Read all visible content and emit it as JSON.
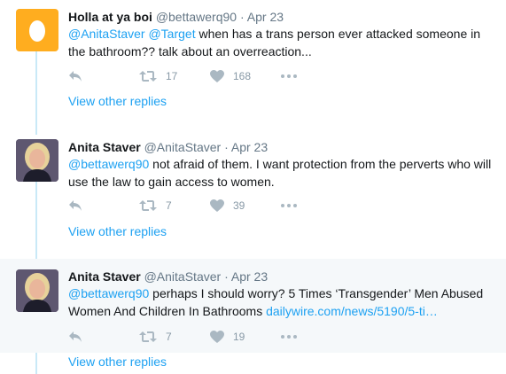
{
  "tweets": [
    {
      "name": "Holla at ya boi",
      "handle": "@bettawerq90",
      "separator": "·",
      "time": "Apr 23",
      "text_mentions": "@AnitaStaver @Target",
      "text_body": " when has a trans person ever attacked someone in the bathroom?? talk about an overreaction...",
      "retweets": "17",
      "likes": "168",
      "more_replies": "View other replies",
      "avatar": "egg-avatar-icon"
    },
    {
      "name": "Anita Staver",
      "handle": "@AnitaStaver",
      "separator": "·",
      "time": "Apr 23",
      "text_mentions": "@bettawerq90",
      "text_body": " not afraid of them. I want protection from the perverts who will use the law to gain access to women.",
      "retweets": "7",
      "likes": "39",
      "more_replies": "View other replies",
      "avatar": "profile-photo"
    },
    {
      "name": "Anita Staver",
      "handle": "@AnitaStaver",
      "separator": "·",
      "time": "Apr 23",
      "text_mentions": "@bettawerq90",
      "text_body": " perhaps I should worry? 5 Times ‘Transgender’ Men Abused Women And Children In Bathrooms ",
      "text_link": "dailywire.com/news/5190/5-ti…",
      "retweets": "7",
      "likes": "19",
      "more_replies": "View other replies",
      "avatar": "profile-photo"
    }
  ],
  "colors": {
    "link": "#1da1f2",
    "muted": "#657786",
    "icon": "#aab8c2",
    "thread_line": "#c9e9f7",
    "highlight_bg": "#f5f8fa",
    "egg": "#ffad1f"
  }
}
